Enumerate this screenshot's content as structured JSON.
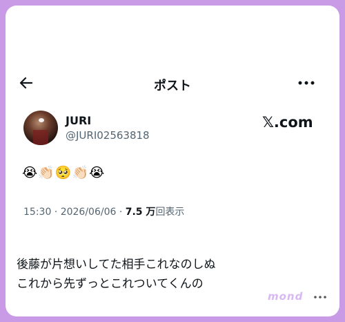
{
  "header": {
    "title": "ポスト"
  },
  "user": {
    "name": "JURI",
    "handle": "@JURI02563818"
  },
  "brand": "𝕏.com",
  "emojis": "😭👏🏻🥺👏🏻😭",
  "meta": {
    "time_date": "15:30 · 2026/06/06 · ",
    "views_count": "7.5 万",
    "views_label": "回表示"
  },
  "caption": {
    "line1": "後藤が片想いしてた相手これなのしぬ",
    "line2": "これから先ずっとこれついてくんの"
  },
  "watermark": "mond",
  "colors": {
    "background": "#c99ae6",
    "card": "#ffffff",
    "text": "#0f1419",
    "secondary": "#536471"
  }
}
